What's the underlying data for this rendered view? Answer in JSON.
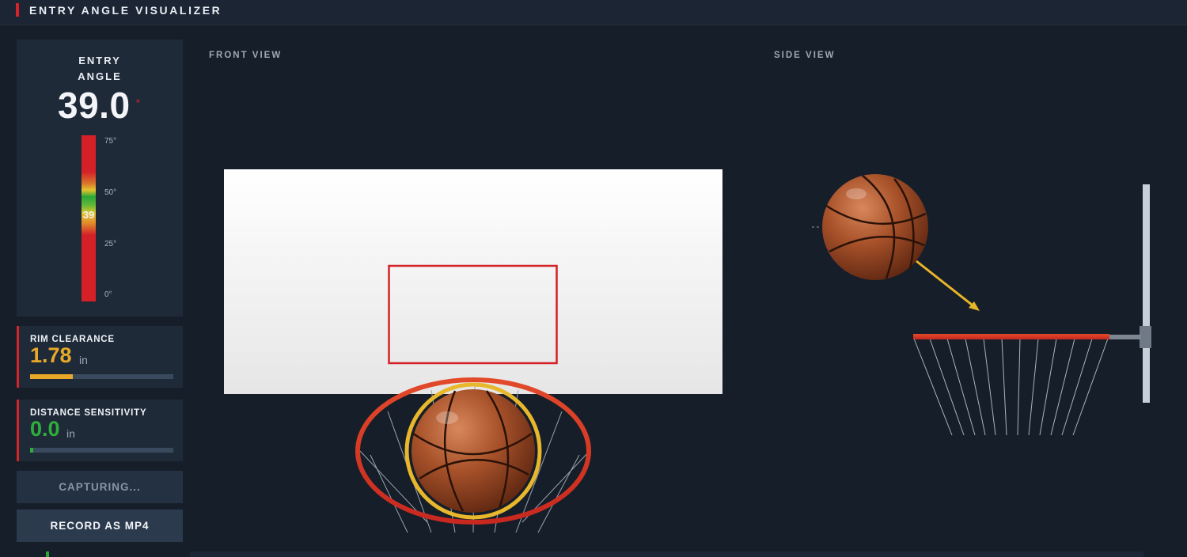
{
  "app": {
    "title": "ENTRY ANGLE VISUALIZER"
  },
  "entry_angle": {
    "label_line1": "ENTRY",
    "label_line2": "ANGLE",
    "value": "39.0",
    "unit": "°",
    "gauge_marker": "39",
    "gauge_value": 39,
    "gauge_max": 75,
    "ticks": [
      "75°",
      "50°",
      "25°",
      "0°"
    ]
  },
  "rim_clearance": {
    "label": "RIM CLEARANCE",
    "value": "1.78",
    "unit": "in",
    "value_color": "#e8a929",
    "bar_fraction": 0.3,
    "bar_color": "#e8a929"
  },
  "distance_sensitivity": {
    "label": "DISTANCE SENSITIVITY",
    "value": "0.0",
    "unit": "in",
    "value_color": "#2eae3a",
    "bar_fraction": 0.02,
    "bar_color": "#2eae3a"
  },
  "buttons": {
    "capturing": "CAPTURING...",
    "record": "RECORD AS MP4"
  },
  "views": {
    "front": "FRONT VIEW",
    "side": "SIDE VIEW"
  },
  "colors": {
    "accent_red": "#d62229",
    "trajectory": "#e8b429",
    "rim_orange": "#e2452a",
    "ball_ring": "#e9b72b",
    "ball": "#a8522a"
  }
}
